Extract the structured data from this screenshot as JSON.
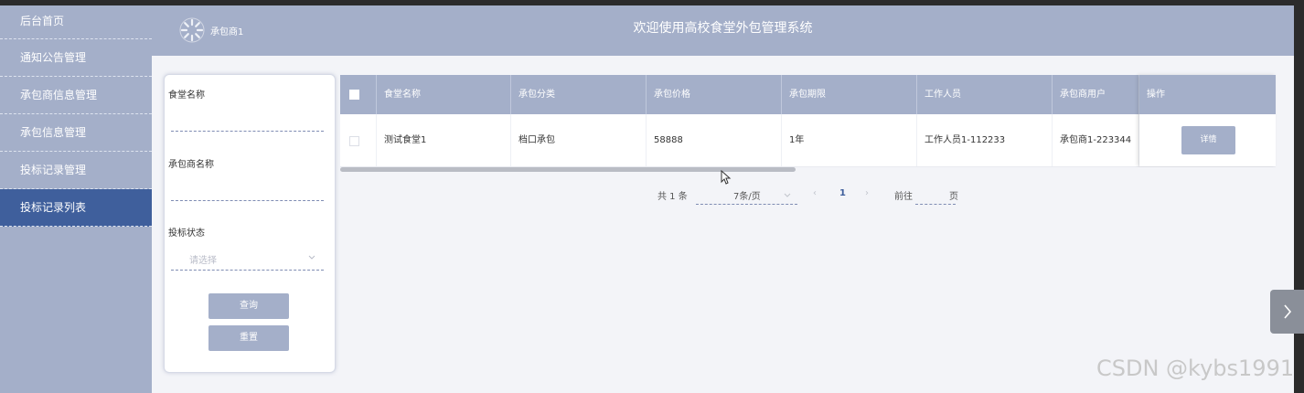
{
  "sidebar": {
    "items": [
      {
        "label": "后台首页"
      },
      {
        "label": "通知公告管理"
      },
      {
        "label": "承包商信息管理"
      },
      {
        "label": "承包信息管理"
      },
      {
        "label": "投标记录管理"
      },
      {
        "label": "投标记录列表"
      }
    ]
  },
  "header": {
    "user_name": "承包商1",
    "title": "欢迎使用高校食堂外包管理系统"
  },
  "search": {
    "canteen_label": "食堂名称",
    "contractor_label": "承包商名称",
    "status_label": "投标状态",
    "status_placeholder": "请选择",
    "query_button": "查询",
    "reset_button": "重置"
  },
  "table": {
    "columns": [
      "食堂名称",
      "承包分类",
      "承包价格",
      "承包期限",
      "工作人员",
      "承包商用户",
      "操作"
    ],
    "rows": [
      {
        "canteen": "测试食堂1",
        "category": "档口承包",
        "price": "58888",
        "term": "1年",
        "staff": "工作人员1-112233",
        "contractor": "承包商1-223344",
        "action": "详情"
      }
    ]
  },
  "pagination": {
    "total": "共 1 条",
    "page_size": "7条/页",
    "prev": "‹",
    "current": "1",
    "next": "›",
    "goto": "前往",
    "page_unit": "页"
  },
  "watermark": "CSDN @kybs1991",
  "colors": {
    "sidebar": "#a4afc9",
    "active": "#3f5f9c",
    "accent": "#3f5f9c"
  }
}
